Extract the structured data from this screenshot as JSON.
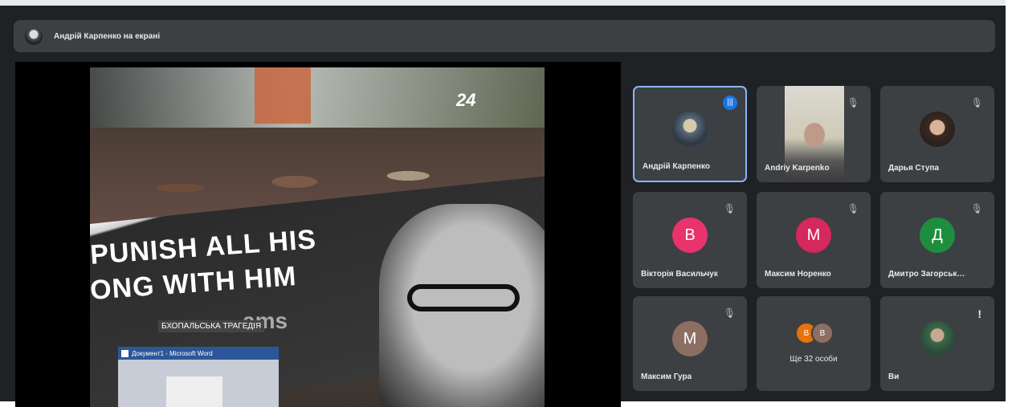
{
  "presenter_bar": {
    "text": "Андрій Карпенко на екрані",
    "avatar_icon": "user-avatar"
  },
  "shared_screen": {
    "channel_logo": "24",
    "banner_line1": "PUNISH ALL HIS",
    "banner_line2": "ONG WITH HIM",
    "banner_line3": "ams",
    "caption": "БХОПАЛЬСЬКА ТРАГЕДІЯ",
    "word_window_title": "Документ1 - Microsoft Word"
  },
  "participants": [
    {
      "name": "Андрій Карпенко",
      "type": "avatar-photo",
      "speaking": true
    },
    {
      "name": "Andriy Karpenko",
      "type": "video",
      "muted": true
    },
    {
      "name": "Дарья Ступа",
      "type": "avatar-photo",
      "muted": true
    },
    {
      "name": "Вікторія Васильчук",
      "initial": "В",
      "color": "#e8336d",
      "muted": true
    },
    {
      "name": "Максим Норенко",
      "initial": "М",
      "color": "#d5285d",
      "muted": true
    },
    {
      "name": "Дмитро Загорськ…",
      "initial": "Д",
      "color": "#1e8e3e",
      "muted": true
    },
    {
      "name": "Максим Гура",
      "initial": "М",
      "color": "#8d6e63",
      "muted": true
    },
    {
      "more_label": "Ще 32 особи",
      "more_initials": [
        "В",
        "В"
      ],
      "more_colors": [
        "#e8710a",
        "#8d6e63"
      ]
    },
    {
      "name": "Ви",
      "type": "avatar-photo",
      "alert": "!"
    }
  ],
  "colors": {
    "background": "#202124",
    "tile": "#3c4043",
    "active_border": "#8ab4f8",
    "speaking_badge": "#1a73e8"
  }
}
